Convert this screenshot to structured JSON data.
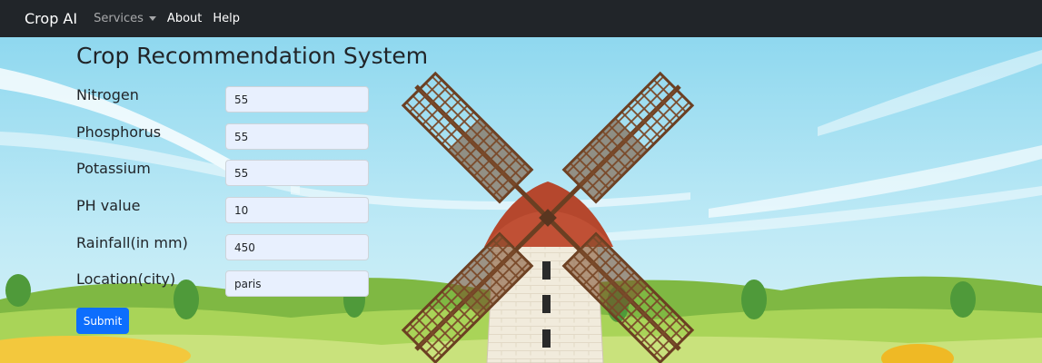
{
  "colors": {
    "navbar_bg": "#212529",
    "primary": "#0d6efd",
    "input_bg": "#e8f0fe",
    "sky": "#aee4f4",
    "grass": "#9fd14f"
  },
  "navbar": {
    "brand": "Crop AI",
    "items": [
      {
        "label": "Services",
        "dropdown": true
      },
      {
        "label": "About"
      },
      {
        "label": "Help"
      }
    ]
  },
  "page": {
    "title": "Crop Recommendation System"
  },
  "form": {
    "fields": [
      {
        "label": "Nitrogen",
        "value": "55"
      },
      {
        "label": "Phosphorus",
        "value": "55"
      },
      {
        "label": "Potassium",
        "value": "55"
      },
      {
        "label": "PH value",
        "value": "10"
      },
      {
        "label": "Rainfall(in mm)",
        "value": "450"
      },
      {
        "label": "Location(city)",
        "value": "paris"
      }
    ],
    "submit_label": "Submit"
  },
  "background": {
    "illustration": "windmill-illustration"
  }
}
